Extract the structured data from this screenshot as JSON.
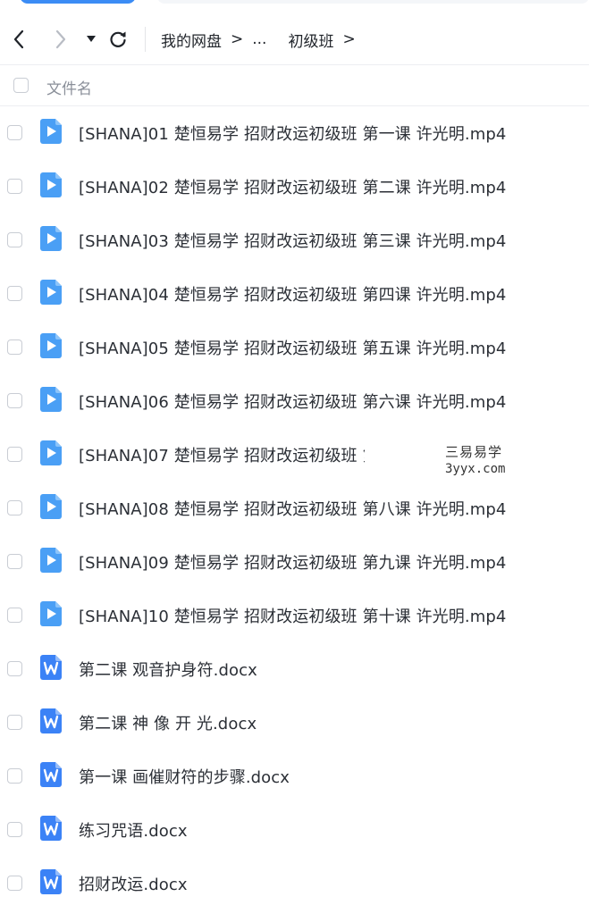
{
  "breadcrumb": {
    "root": "我的网盘",
    "ellipsis": "...",
    "current": "初级班"
  },
  "header": {
    "column_label": "文件名"
  },
  "icons": {
    "video": "video-file-icon",
    "word": "word-doc-icon"
  },
  "colors": {
    "accent": "#3b8cf5",
    "video_icon": "#4a9ff5",
    "word_icon": "#3b82f6"
  },
  "files": [
    {
      "name": "[SHANA]01 楚恒易学 招财改运初级班 第一课 许光明.mp4",
      "type": "video"
    },
    {
      "name": "[SHANA]02 楚恒易学 招财改运初级班 第二课 许光明.mp4",
      "type": "video"
    },
    {
      "name": "[SHANA]03 楚恒易学 招财改运初级班 第三课 许光明.mp4",
      "type": "video"
    },
    {
      "name": "[SHANA]04 楚恒易学 招财改运初级班 第四课 许光明.mp4",
      "type": "video"
    },
    {
      "name": "[SHANA]05 楚恒易学 招财改运初级班 第五课 许光明.mp4",
      "type": "video"
    },
    {
      "name": "[SHANA]06 楚恒易学 招财改运初级班 第六课 许光明.mp4",
      "type": "video"
    },
    {
      "name": "[SHANA]07 楚恒易学 招财改运初级班 第",
      "type": "video"
    },
    {
      "name": "[SHANA]08 楚恒易学 招财改运初级班 第八课 许光明.mp4",
      "type": "video"
    },
    {
      "name": "[SHANA]09 楚恒易学 招财改运初级班 第九课 许光明.mp4",
      "type": "video"
    },
    {
      "name": "[SHANA]10 楚恒易学 招财改运初级班 第十课 许光明.mp4",
      "type": "video"
    },
    {
      "name": "第二课 观音护身符.docx",
      "type": "word"
    },
    {
      "name": "第二课 神 像 开 光.docx",
      "type": "word"
    },
    {
      "name": "第一课 画催财符的步骤.docx",
      "type": "word"
    },
    {
      "name": "练习咒语.docx",
      "type": "word"
    },
    {
      "name": "招财改运.docx",
      "type": "word"
    }
  ],
  "watermark": {
    "line1": "三易易学",
    "line2": "3yyx.com"
  }
}
